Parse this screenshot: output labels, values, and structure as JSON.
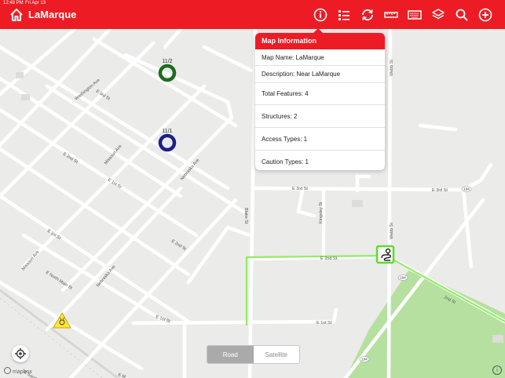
{
  "status_bar": {
    "time": "12:48 PM",
    "date": "Fri Apr 13",
    "battery": ""
  },
  "header": {
    "title": "LaMarque",
    "icons": [
      "home-icon",
      "info-icon",
      "layers-list-icon",
      "sync-icon",
      "ruler-icon",
      "keyboard-icon",
      "layers-icon",
      "search-icon",
      "add-icon"
    ]
  },
  "popover": {
    "title": "Map Information",
    "map_name": "Map Name: LaMarque",
    "description": "Description: Near LaMarque",
    "total_features": "Total Features: 4",
    "structures": "Structures: 2",
    "access_types": "Access Types: 1",
    "caution_types": "Caution Types: 1"
  },
  "markers": {
    "structure_1": "11/2",
    "structure_2": "11/1",
    "structure_1_color": "#1e6b1e",
    "structure_2_color": "#1a1f8a"
  },
  "map_labels": {
    "washington_ave": "Washington Ave",
    "e3rd_st_a": "E 3rd St",
    "missouri_ave": "Missouri Ave",
    "e2nd_st_a": "E 2nd St",
    "nebraska_ave": "Nebraska Ave",
    "e1st_st_a": "E 1st St",
    "e2nd_st_b": "E 2nd St",
    "missouri_ave_b": "Missouri Ave",
    "e_north_main_st": "E North Main St",
    "nebraska_ave_b": "Nebraska Ave",
    "e1st_st_b": "E 1st St",
    "e_south": "E South",
    "blake_st": "Blake St",
    "kingsley_st": "Kingsley St",
    "webb_st": "Webb St",
    "webb_st_top": "Webb St",
    "e3rd_st_east": "E 3rd St",
    "e3rd_st_mid": "E 3rd St",
    "e2nd_st_east": "E 2nd St",
    "e2nd_st_far": "2nd St",
    "e1st_st_c": "E 1st St",
    "e1st_st_d": "E 1st St",
    "e_main": "E M",
    "route_194_a": "194",
    "route_194_b": "194",
    "route_194_c": "194"
  },
  "map_type": {
    "road": "Road",
    "satellite": "Satellite",
    "selected": "Road"
  },
  "attribution": "mapbox",
  "colors": {
    "accent": "#ed1c24",
    "route": "#90ee60",
    "park": "#b6e0a0"
  }
}
